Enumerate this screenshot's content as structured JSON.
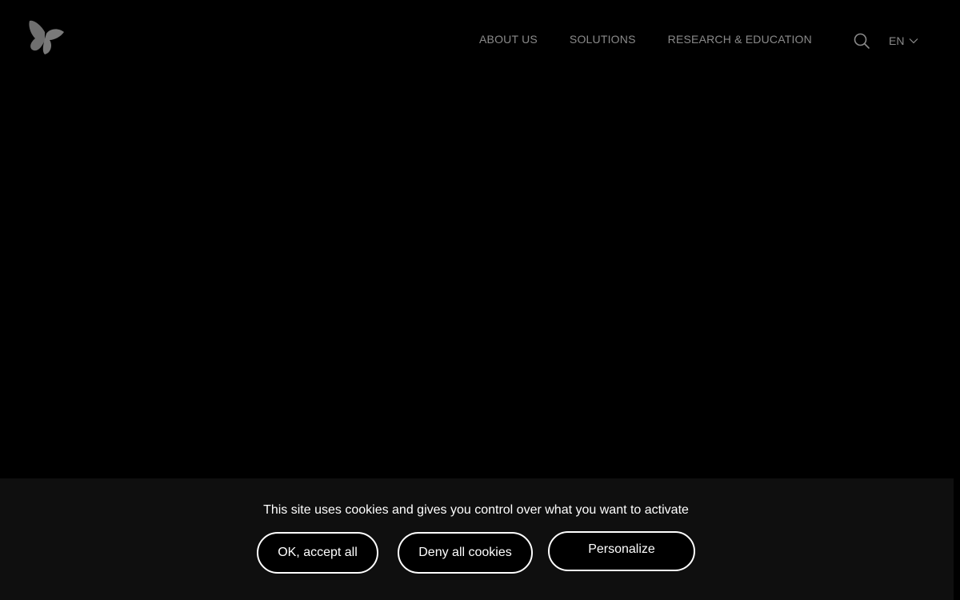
{
  "header": {
    "logo_icon": "butterfly-icon",
    "nav": [
      {
        "label": "ABOUT US"
      },
      {
        "label": "SOLUTIONS"
      },
      {
        "label": "RESEARCH & EDUCATION"
      }
    ],
    "search_icon": "search-icon",
    "language": {
      "selected": "EN",
      "icon": "chevron-down-icon"
    }
  },
  "cookie_banner": {
    "message": "This site uses cookies and gives you control over what you want to activate",
    "accept_label": "OK, accept all",
    "deny_label": "Deny all cookies",
    "personalize_label": "Personalize"
  },
  "colors": {
    "background": "#000000",
    "banner_background": "#0f0f0f",
    "nav_text": "#8a8a8a",
    "button_border": "#ffffff"
  }
}
